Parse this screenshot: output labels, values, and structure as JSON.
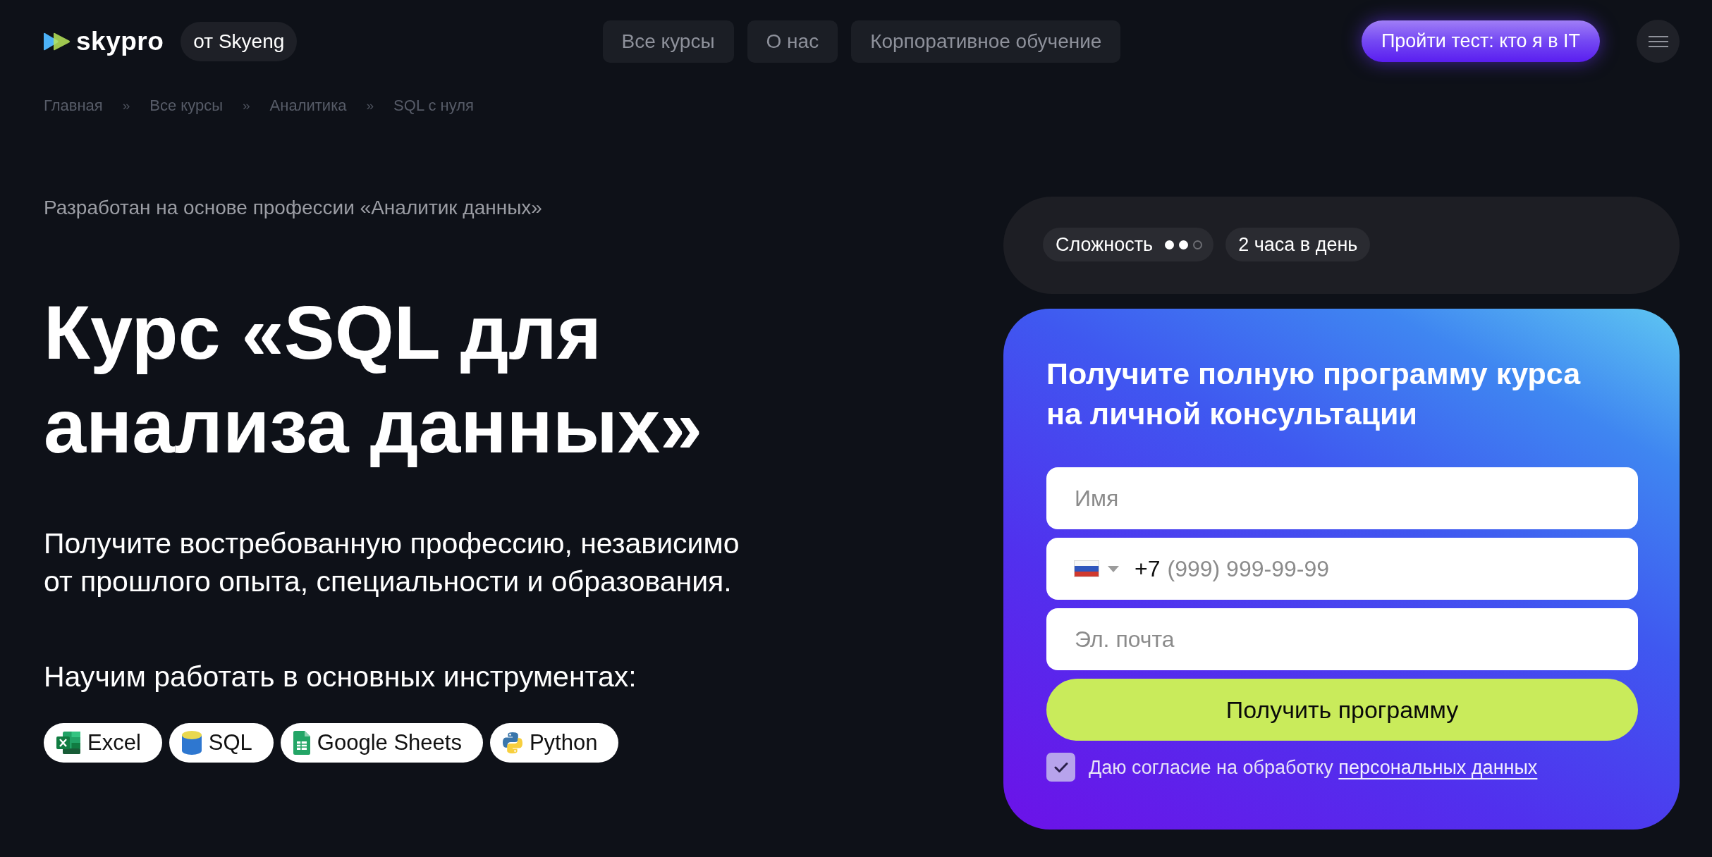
{
  "header": {
    "logo": "skypro",
    "brand_tag": "от Skyeng",
    "nav": [
      {
        "label": "Все курсы"
      },
      {
        "label": "О нас"
      },
      {
        "label": "Корпоративное обучение"
      }
    ],
    "cta": "Пройти тест: кто я в IT"
  },
  "breadcrumbs": [
    {
      "kind": "link",
      "text": "Главная"
    },
    {
      "kind": "separator",
      "text": "»"
    },
    {
      "kind": "link",
      "text": "Все курсы"
    },
    {
      "kind": "separator",
      "text": "»"
    },
    {
      "kind": "link",
      "text": "Аналитика"
    },
    {
      "kind": "separator",
      "text": "»"
    },
    {
      "kind": "link",
      "text": "SQL с нуля"
    }
  ],
  "hero": {
    "eyebrow": "Разработан на основе профессии «Аналитик данных»",
    "title": "Курс «SQL для анализа данных»",
    "description": "Получите востребованную профессию, независимо от прошлого опыта, специальности и образования.",
    "tools_heading": "Научим работать в основных инструментах:",
    "tools": [
      {
        "label": "Excel"
      },
      {
        "label": "SQL"
      },
      {
        "label": "Google Sheets"
      },
      {
        "label": "Python"
      }
    ]
  },
  "course_info": {
    "difficulty": {
      "label": "Сложность",
      "stars": 2
    },
    "duration": "2 часа в день"
  },
  "form": {
    "title": "Получите полную программу курса на личной консультации",
    "fields": [
      {
        "kind": "text",
        "placeholder": "Имя"
      },
      {
        "kind": "phone",
        "prefix": "+7",
        "placeholder": "(999) 999-99-99"
      },
      {
        "kind": "text",
        "placeholder": "Эл. почта"
      }
    ],
    "submit": "Получить программу",
    "consent": {
      "checked": true,
      "text": "Даю согласие на обработку",
      "link": "персональных данных"
    }
  }
}
